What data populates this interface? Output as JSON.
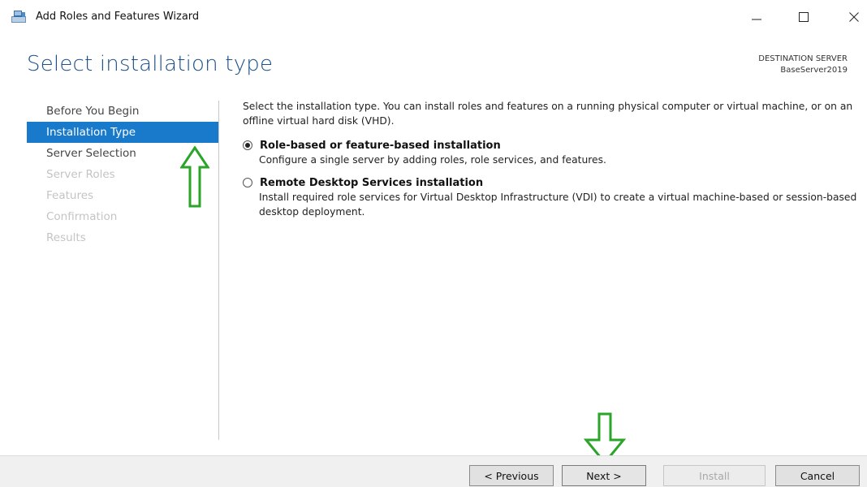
{
  "window": {
    "title": "Add Roles and Features Wizard",
    "icon": "server-manager-icon",
    "controls": [
      "minimize-icon",
      "maximize-icon",
      "close-icon"
    ]
  },
  "page": {
    "heading": "Select installation type",
    "destination_label": "DESTINATION SERVER",
    "destination_value": "BaseServer2019"
  },
  "nav": {
    "items": [
      {
        "label": "Before You Begin",
        "state": "enabled"
      },
      {
        "label": "Installation Type",
        "state": "active"
      },
      {
        "label": "Server Selection",
        "state": "enabled"
      },
      {
        "label": "Server Roles",
        "state": "disabled"
      },
      {
        "label": "Features",
        "state": "disabled"
      },
      {
        "label": "Confirmation",
        "state": "disabled"
      },
      {
        "label": "Results",
        "state": "disabled"
      }
    ]
  },
  "content": {
    "description": "Select the installation type. You can install roles and features on a running physical computer or virtual machine, or on an offline virtual hard disk (VHD).",
    "options": [
      {
        "label": "Role-based or feature-based installation",
        "description": "Configure a single server by adding roles, role services, and features.",
        "selected": true
      },
      {
        "label": "Remote Desktop Services installation",
        "description": "Install required role services for Virtual Desktop Infrastructure (VDI) to create a virtual machine-based or session-based desktop deployment.",
        "selected": false
      }
    ]
  },
  "footer": {
    "previous": "< Previous",
    "next": "Next >",
    "install": "Install",
    "cancel": "Cancel"
  },
  "colors": {
    "heading": "#1d4f8a",
    "nav_active_bg": "#1979ca",
    "annotation_arrow": "#2aa52a"
  }
}
